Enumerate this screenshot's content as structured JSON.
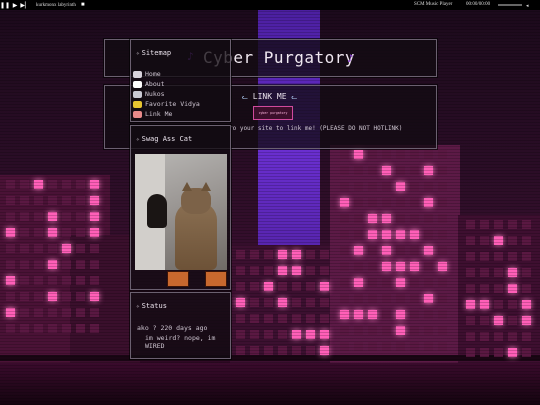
{
  "player": {
    "track": "kurkmonx labyrinth",
    "title": "SCM Music Player",
    "time": "00:00/00:00"
  },
  "header": {
    "title": "Cyber Purgatory",
    "note_icon": "music-note-icon",
    "accent": "#8b3fd0"
  },
  "sitemap": {
    "title": "Sitemap",
    "items": [
      {
        "label": "Home",
        "icon": "cat-icon",
        "color": "#d8d3db"
      },
      {
        "label": "About",
        "icon": "cat-icon",
        "color": "#ffffff"
      },
      {
        "label": "Nukos",
        "icon": "cat-icon",
        "color": "#c9c9d3"
      },
      {
        "label": "Favorite Vidya",
        "icon": "cat-icon",
        "color": "#e6c430"
      },
      {
        "label": "Link Me",
        "icon": "cat-icon",
        "color": "#e88a8a"
      }
    ]
  },
  "linkme": {
    "title": "LINK ME",
    "badge": "cyber purgatory",
    "text": "ro your site to link me! (PLEASE DO NOT HOTLINK)"
  },
  "cat": {
    "title": "Swag Ass Cat"
  },
  "status": {
    "title": "Status",
    "time": "ako ? 220 days ago",
    "message": "im weird? nope, im WIRED"
  },
  "colors": {
    "window_light": "#ff5fb8",
    "border": "#6b6070"
  }
}
